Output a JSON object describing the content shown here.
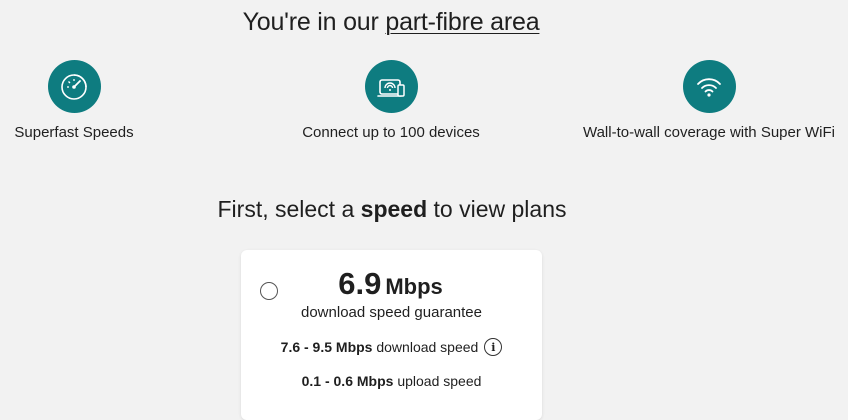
{
  "header": {
    "title_prefix": "You're in our",
    "title_link": "part-fibre area"
  },
  "features": [
    {
      "icon": "speedometer-icon",
      "label": "Superfast Speeds"
    },
    {
      "icon": "devices-icon",
      "label": "Connect up to 100 devices"
    },
    {
      "icon": "wifi-icon",
      "label": "Wall-to-wall coverage with Super WiFi"
    }
  ],
  "speed_select": {
    "prefix": "First, select a",
    "bold": "speed",
    "suffix": "to view plans"
  },
  "plan_card": {
    "speed_value": "6.9",
    "speed_unit": "Mbps",
    "guarantee_text": "download speed guarantee",
    "download_range": "7.6 - 9.5 Mbps",
    "download_label": "download speed",
    "upload_range": "0.1 - 0.6 Mbps",
    "upload_label": "upload speed",
    "info_glyph": "i",
    "selected": false
  },
  "colors": {
    "accent_teal": "#0e7c80",
    "background": "#f2f2f2",
    "card": "#ffffff"
  }
}
